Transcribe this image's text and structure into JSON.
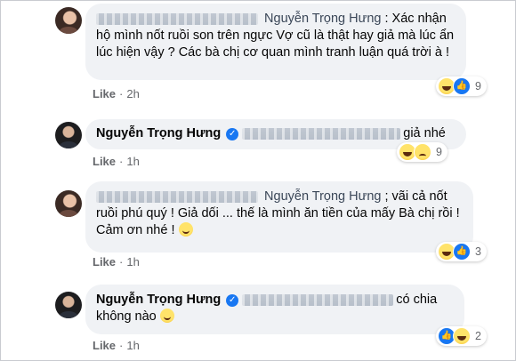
{
  "comments": [
    {
      "author": "Nguyễn Trọng Hưng",
      "text": ": Xác nhận hộ mình nốt ruồi son trên ngực Vợ cũ là thật hay giả mà lúc ẩn lúc hiện vậy ? Các bà chị cơ quan mình tranh luận quá trời à !",
      "like": "Like",
      "time": "2h",
      "reaction_count": "9"
    },
    {
      "author": "Nguyễn Trọng Hưng",
      "verified": "✓",
      "text": "giả nhé",
      "like": "Like",
      "time": "1h",
      "reaction_count": "9"
    },
    {
      "author": "Nguyễn Trọng Hưng",
      "text": "; vãi cả nốt ruồi phú quý ! Giả dối ... thế là mình ăn tiền của mấy Bà chị rồi ! Cảm ơn nhé !",
      "like": "Like",
      "time": "1h",
      "reaction_count": "3"
    },
    {
      "author": "Nguyễn Trọng Hưng",
      "verified": "✓",
      "text": "có chia không nào",
      "like": "Like",
      "time": "1h",
      "reaction_count": "2"
    }
  ],
  "icons": {
    "verified": "verified-badge-icon",
    "haha": "haha-reaction-icon",
    "sad": "sad-reaction-icon",
    "like": "like-reaction-icon"
  },
  "colors": {
    "bubble": "#f0f2f5",
    "accent": "#1877f2",
    "meta": "#65676b"
  }
}
